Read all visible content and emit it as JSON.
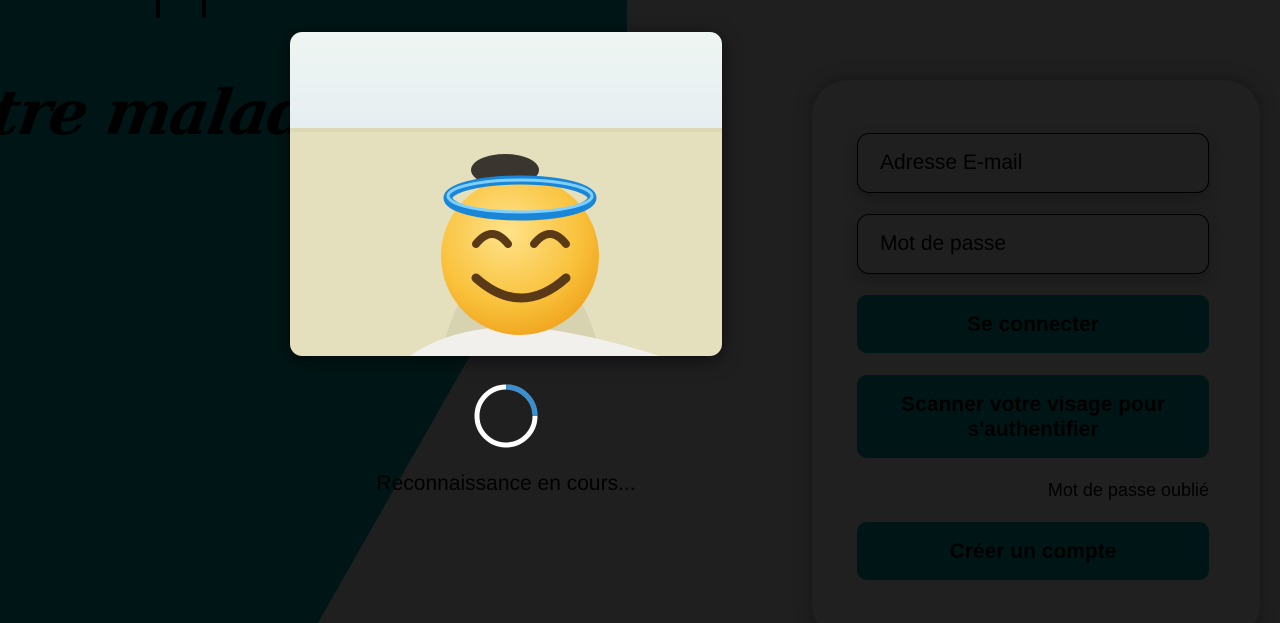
{
  "brand": {
    "tagline_fragment": "tre malade"
  },
  "login": {
    "email_placeholder": "Adresse E-mail",
    "password_placeholder": "Mot de passe",
    "login_label": "Se connecter",
    "face_scan_label": "Scanner votre visage pour s'authentifier",
    "forgot_label": "Mot de passe oublié",
    "create_account_label": "Créer un compte"
  },
  "face_modal": {
    "status_text": "Reconnaissance en cours...",
    "camera_feed": "webcam-preview",
    "face_overlay": "smiling-face-with-halo-emoji"
  },
  "colors": {
    "dark_teal": "#001616",
    "background": "#1f1f1f",
    "spinner_track": "#ffffff",
    "spinner_arc": "#3a8fd0"
  }
}
